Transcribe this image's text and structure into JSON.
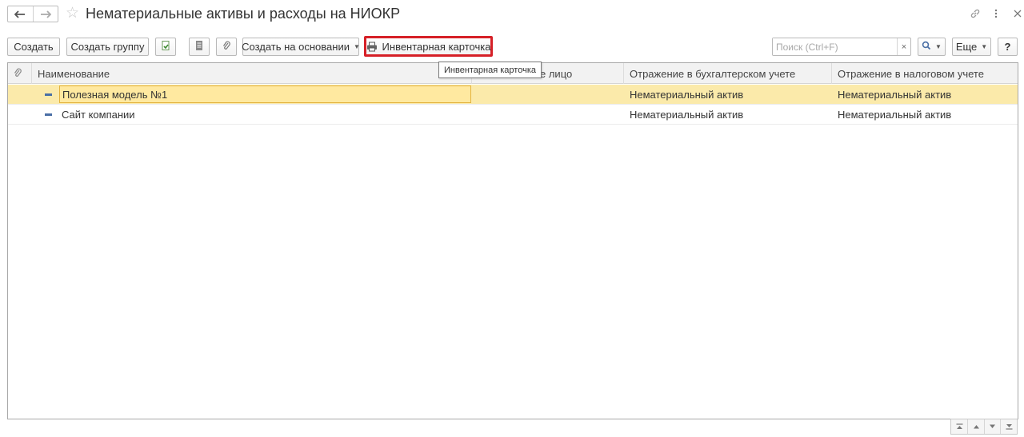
{
  "window": {
    "title": "Нематериальные активы и расходы на НИОКР",
    "back_icon": "arrow-left-icon",
    "forward_icon": "arrow-right-icon",
    "favorite_icon": "star-icon",
    "link_icon": "link-icon",
    "menu_icon": "more-vertical-icon",
    "close_icon": "close-icon"
  },
  "toolbar": {
    "create_label": "Создать",
    "create_group_label": "Создать группу",
    "create_based_label": "Создать на основании",
    "inventory_card_label": "Инвентарная карточка",
    "more_label": "Еще",
    "help_label": "?",
    "search_placeholder": "Поиск (Ctrl+F)",
    "search_clear": "×",
    "highlight_color": "#d62027"
  },
  "tooltip": {
    "text": "Инвентарная карточка"
  },
  "table": {
    "columns": {
      "name": "Наименование",
      "responsible": "е лицо",
      "accounting": "Отражение в бухгалтерском учете",
      "tax": "Отражение в налоговом учете"
    },
    "rows": [
      {
        "name": "Полезная модель №1",
        "responsible": "",
        "accounting": "Нематериальный актив",
        "tax": "Нематериальный актив",
        "selected": true
      },
      {
        "name": "Сайт компании",
        "responsible": "",
        "accounting": "Нематериальный актив",
        "tax": "Нематериальный актив",
        "selected": false
      }
    ],
    "selected_color": "#fbeaaa"
  }
}
